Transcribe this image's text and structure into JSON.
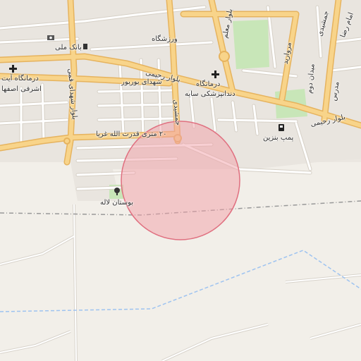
{
  "map": {
    "labels": {
      "bank_melli": "بانک ملی",
      "varzeshgah": "ورزشگاه",
      "blvd_moallem": "بلوار معلم",
      "blvd_rahimi_top": "بلوار رحیمی",
      "shohada_bourbour": "شهدای بوربور",
      "blvd_shohada_qomi": "بلوار شهدای قمی",
      "clinic_ayatollah_line1": "درمانگاه آیت",
      "clinic_ayatollah_line2": "اشرفی اصفها",
      "clinic_sayeh_line1": "درمانگاه",
      "clinic_sayeh_line2": "دندانپزشکی سایه",
      "blvd_rahimi_right": "بلوار رحیمی",
      "morvarid": "مروارید",
      "dovom": "میدان دوم",
      "modarres": "مدرس",
      "imam_reza": "امام رضا",
      "jamshidi": "جمشیدی",
      "street_20m": "۲۰ متری قدرت الله غریا",
      "street_vertical_mid": "جمشیدی",
      "gas_station": "پمپ بنزین",
      "bostan_laleh": "بوستان لاله"
    },
    "icons": [
      "bank-icon",
      "fuel-icon",
      "hospital-icon",
      "fuel-station-icon",
      "park-tree-icon"
    ],
    "colors": {
      "background": "#f2efe9",
      "major_road": "#f8d48a",
      "major_road_casing": "#e6b35e",
      "minor_road": "#ffffff",
      "minor_road_casing": "#d6d0c6",
      "park": "#c8e6b8",
      "circle_fill": "#f2a0a8",
      "circle_stroke": "#e07080",
      "rail": "#999999",
      "boundary": "#9ec3f0"
    }
  }
}
